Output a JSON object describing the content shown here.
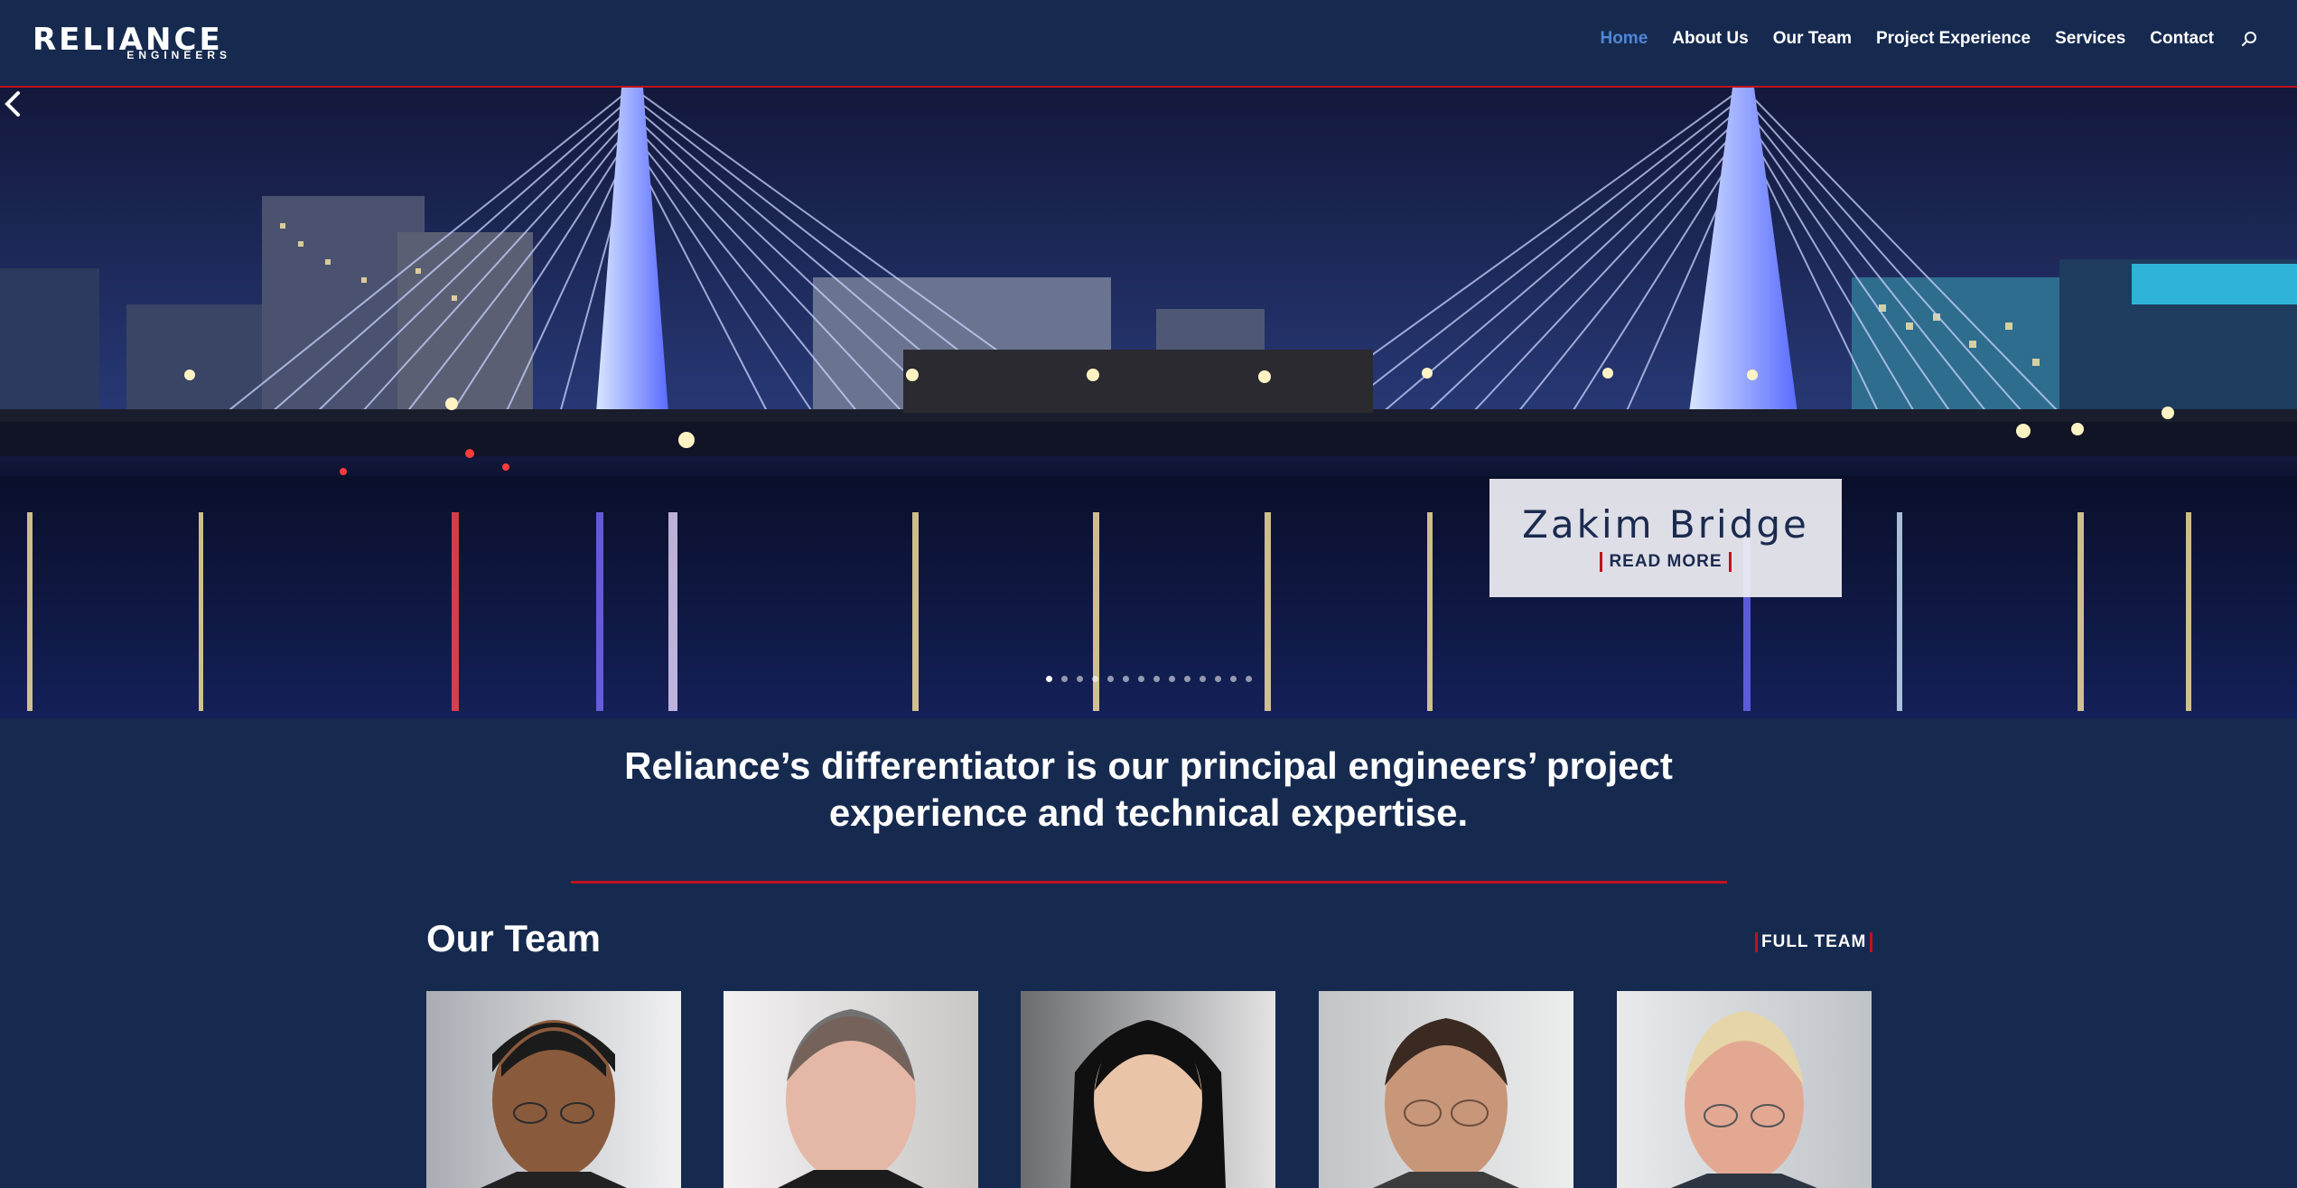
{
  "header": {
    "logo_text": "RELIANCE",
    "logo_sub": "ENGINEERS",
    "nav": [
      "Home",
      "About Us",
      "Our Team",
      "Project Experience",
      "Services",
      "Contact"
    ],
    "active_nav": "Home"
  },
  "hero": {
    "caption_title": "Zakim Bridge",
    "read_more": "READ MORE",
    "slide_count": 14,
    "active_slide": 1
  },
  "tagline": "Reliance’s differentiator is our principal engineers’ project experience and technical expertise.",
  "team": {
    "title": "Our Team",
    "full_team": "FULL TEAM",
    "members": [
      {
        "photo": "team-member-photo"
      },
      {
        "photo": "team-member-photo"
      },
      {
        "photo": "team-member-photo"
      },
      {
        "photo": "team-member-photo"
      },
      {
        "photo": "team-member-photo"
      }
    ]
  },
  "colors": {
    "background": "#162a4f",
    "accent_red": "#c1121f",
    "nav_active": "#4f86d6",
    "caption_text": "#1b2a4f"
  },
  "icons": [
    "search-icon",
    "chevron-left-icon"
  ]
}
